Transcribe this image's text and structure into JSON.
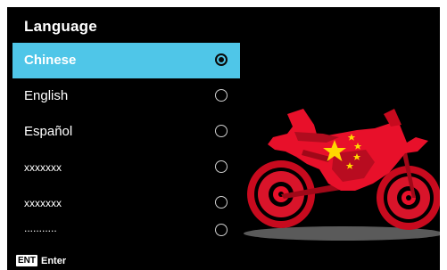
{
  "header": {
    "title": "Language"
  },
  "languages": [
    {
      "label": "Chinese",
      "selected": true
    },
    {
      "label": "English",
      "selected": false
    },
    {
      "label": "Español",
      "selected": false
    },
    {
      "label": "xxxxxxx",
      "selected": false
    },
    {
      "label": "xxxxxxx",
      "selected": false
    },
    {
      "label": "...........",
      "selected": false
    }
  ],
  "footer": {
    "key": "ENT",
    "label": "Enter"
  },
  "illustration": {
    "name": "motorcycle-with-chinese-flag",
    "colors": {
      "body": "#e8102a",
      "stars": "#ffd700",
      "shadow": "#555555"
    }
  },
  "colors": {
    "background": "#000000",
    "highlight": "#4fc6e8"
  }
}
